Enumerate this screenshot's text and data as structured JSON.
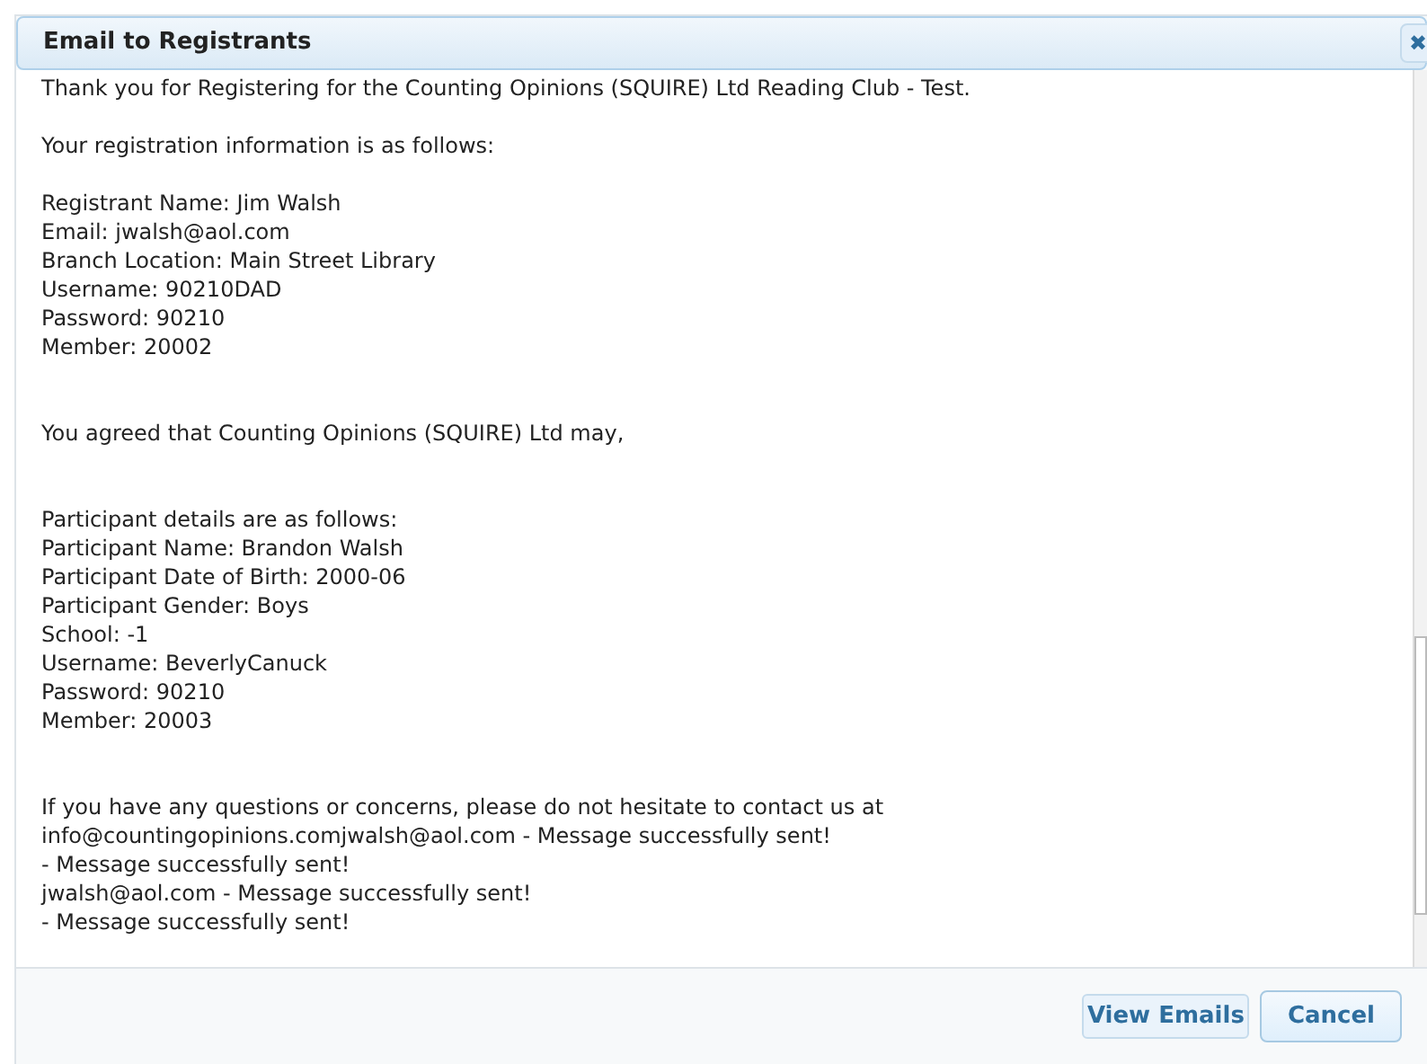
{
  "dialog": {
    "title": "Email to Registrants",
    "close_label": "✖"
  },
  "message": [
    {
      "kind": "first",
      "lines": [
        "Thank you for Registering for the Counting Opinions (SQUIRE) Ltd Reading Club - Test."
      ]
    },
    {
      "kind": "paragraph",
      "lines": [
        "Your registration information is as follows:"
      ]
    },
    {
      "kind": "paragraph",
      "lines": [
        "Registrant Name: Jim Walsh",
        "Email: jwalsh@aol.com",
        "Branch Location: Main Street Library",
        "Username: 90210DAD",
        "Password: 90210",
        "Member: 20002"
      ]
    },
    {
      "kind": "section",
      "lines": [
        "You agreed that Counting Opinions (SQUIRE) Ltd may,"
      ]
    },
    {
      "kind": "section",
      "lines": [
        "Participant details are as follows:",
        "Participant Name: Brandon Walsh",
        "Participant Date of Birth: 2000-06",
        "Participant Gender: Boys",
        "School: -1",
        "Username: BeverlyCanuck",
        "Password: 90210",
        "Member: 20003"
      ]
    },
    {
      "kind": "section",
      "lines": [
        "If you have any questions or concerns, please do not hesitate to contact us at",
        "info@countingopinions.comjwalsh@aol.com - Message successfully sent!",
        "- Message successfully sent!",
        "jwalsh@aol.com - Message successfully sent!",
        "- Message successfully sent!"
      ]
    }
  ],
  "buttons": [
    {
      "label": "View Emails",
      "kind": "link"
    },
    {
      "label": "Cancel",
      "kind": "button"
    }
  ]
}
